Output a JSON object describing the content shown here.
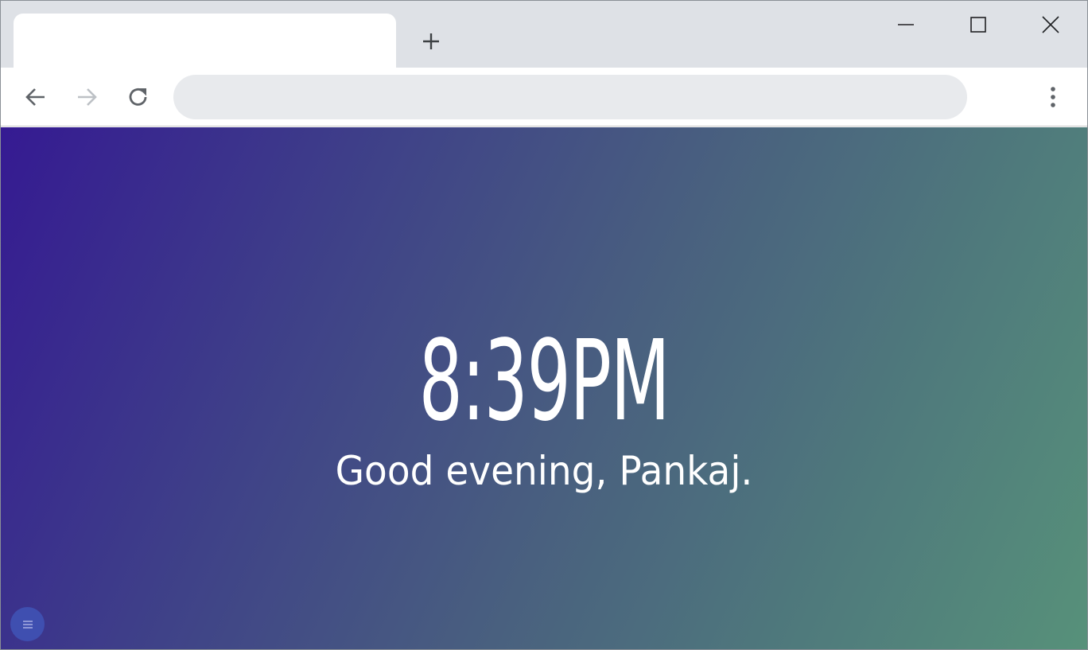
{
  "browser": {
    "tab": {
      "title": ""
    },
    "new_tab_icon": "plus-icon",
    "window_controls": [
      "minimize-icon",
      "maximize-icon",
      "close-icon"
    ],
    "toolbar": {
      "back_icon": "arrow-left-icon",
      "forward_icon": "arrow-right-icon",
      "reload_icon": "reload-icon",
      "address": {
        "value": "",
        "placeholder": ""
      },
      "menu_icon": "vertical-dots-icon"
    }
  },
  "page": {
    "time": "8:39PM",
    "greeting": "Good evening, Pankaj.",
    "menu_icon": "hamburger-icon",
    "colors": {
      "gradient_start": "#351a92",
      "gradient_end": "#57917a",
      "text": "#ffffff",
      "menu_button": "#3f4fb0"
    }
  }
}
